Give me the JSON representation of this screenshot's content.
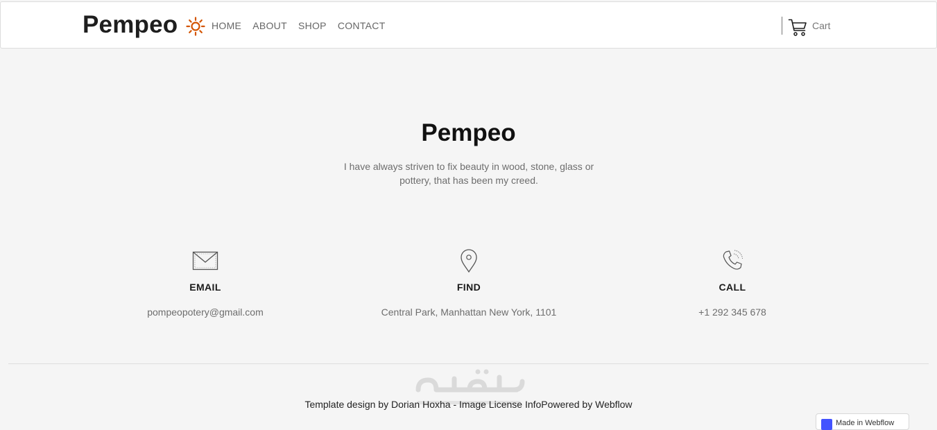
{
  "header": {
    "brand": "Pempeo",
    "brand_icon": "sun-icon",
    "nav": [
      {
        "label": "HOME"
      },
      {
        "label": "ABOUT"
      },
      {
        "label": "SHOP"
      },
      {
        "label": "CONTACT"
      }
    ],
    "cart_label": "Cart",
    "cart_icon": "cart-icon"
  },
  "hero": {
    "title": "Pempeo",
    "text": "I have always striven to fix beauty in wood, stone, glass or pottery, that has been my creed."
  },
  "contact": [
    {
      "icon": "envelope-icon",
      "heading": "EMAIL",
      "value": "pompeopotery@gmail.com"
    },
    {
      "icon": "map-pin-icon",
      "heading": "FIND",
      "value": "Central Park, Manhattan New York, 1101"
    },
    {
      "icon": "phone-icon",
      "heading": "CALL",
      "value": "+1 292 345 678"
    }
  ],
  "footer": {
    "text": "Template design by Dorian Hoxha - Image License InfoPowered by Webflow",
    "badge_label": "Made in Webflow"
  },
  "colors": {
    "accent": "#d35400",
    "background": "#f5f5f5",
    "webflow": "#4353ff"
  }
}
